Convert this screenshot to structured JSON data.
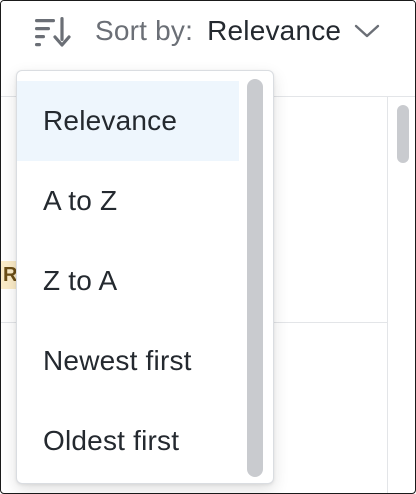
{
  "header": {
    "sort_label": "Sort by:",
    "sort_value": "Relevance",
    "icons": {
      "sort": "sort-lines-arrow-icon",
      "chevron": "chevron-down-icon"
    }
  },
  "background": {
    "tag_text": "R"
  },
  "dropdown": {
    "items": [
      {
        "label": "Relevance",
        "selected": true
      },
      {
        "label": "A to Z",
        "selected": false
      },
      {
        "label": "Z to A",
        "selected": false
      },
      {
        "label": "Newest first",
        "selected": false
      },
      {
        "label": "Oldest first",
        "selected": false
      }
    ]
  },
  "colors": {
    "selected_item_bg": "#eef6fd",
    "text_primary": "#24292f",
    "text_muted": "#6b6f76",
    "scrollbar": "#c9cbcf"
  }
}
